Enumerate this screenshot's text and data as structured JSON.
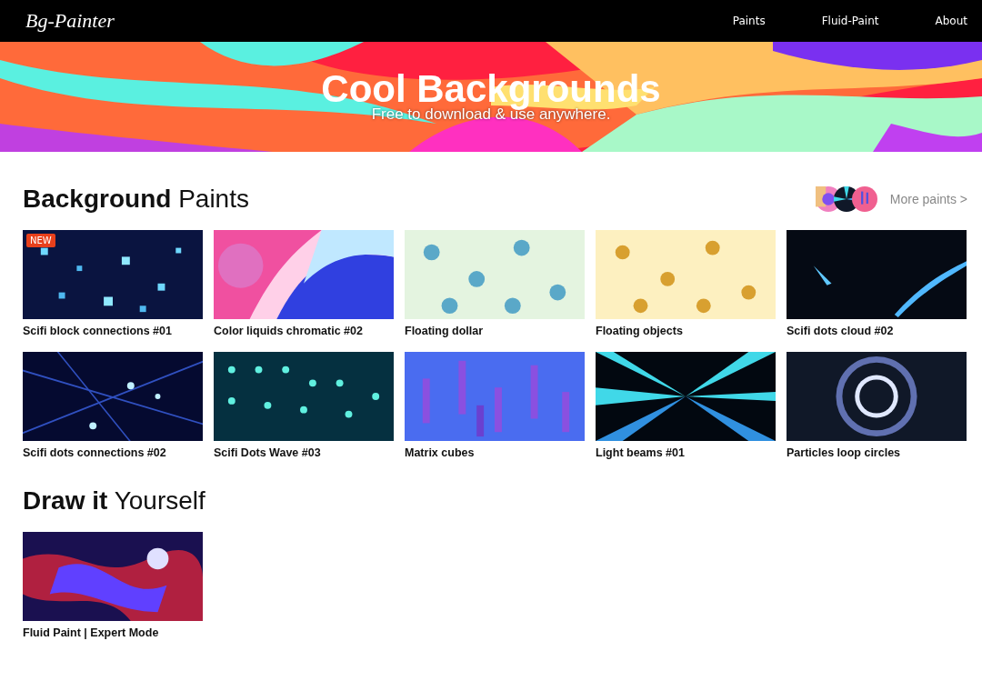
{
  "nav": {
    "logo": "Bg-Painter",
    "links": [
      "Paints",
      "Fluid-Paint",
      "About"
    ]
  },
  "hero": {
    "title": "Cool Backgrounds",
    "subtitle": "Free to download & use anywhere."
  },
  "paints": {
    "heading": "**Background** Paints",
    "more_link": "More paints >",
    "items": [
      {
        "title": "Scifi block connections #01",
        "badge": "NEW"
      },
      {
        "title": "Color liquids chromatic #02"
      },
      {
        "title": "Floating dollar"
      },
      {
        "title": "Floating objects"
      },
      {
        "title": "Scifi dots cloud #02"
      },
      {
        "title": "Scifi dots connections #02"
      },
      {
        "title": "Scifi Dots Wave #03"
      },
      {
        "title": "Matrix cubes"
      },
      {
        "title": "Light beams #01"
      },
      {
        "title": "Particles loop circles"
      }
    ]
  },
  "draw": {
    "heading": "**Draw it** Yourself",
    "items": [
      {
        "title": "Fluid Paint | Expert Mode"
      }
    ]
  }
}
